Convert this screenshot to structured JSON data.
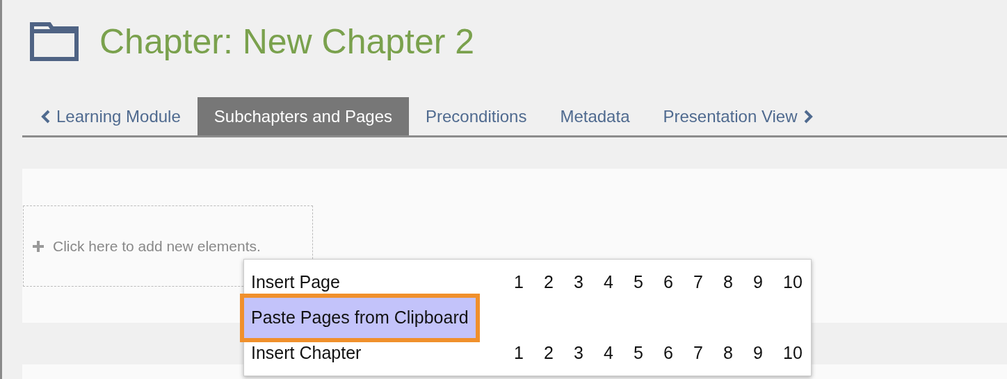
{
  "header": {
    "title": "Chapter: New Chapter 2"
  },
  "tabs": [
    {
      "label": "Learning Module",
      "kind": "back",
      "selected": false
    },
    {
      "label": "Subchapters and Pages",
      "kind": "plain",
      "selected": true
    },
    {
      "label": "Preconditions",
      "kind": "plain",
      "selected": false
    },
    {
      "label": "Metadata",
      "kind": "plain",
      "selected": false
    },
    {
      "label": "Presentation View",
      "kind": "forward",
      "selected": false
    }
  ],
  "add_area": {
    "label": "Click here to add new elements."
  },
  "menu": {
    "items": [
      {
        "kind": "numbered",
        "label": "Insert Page",
        "numbers": [
          "1",
          "2",
          "3",
          "4",
          "5",
          "6",
          "7",
          "8",
          "9",
          "10"
        ],
        "selected": false,
        "outlined": false
      },
      {
        "kind": "plain",
        "label": "Paste Pages from Clipboard",
        "selected": true,
        "outlined": true
      },
      {
        "kind": "numbered",
        "label": "Insert Chapter",
        "numbers": [
          "1",
          "2",
          "3",
          "4",
          "5",
          "6",
          "7",
          "8",
          "9",
          "10"
        ],
        "selected": false,
        "outlined": false
      }
    ]
  }
}
